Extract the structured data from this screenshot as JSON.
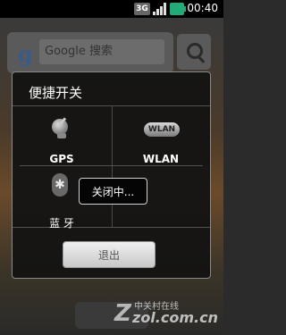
{
  "status_bar": {
    "network": "3G",
    "time": "00:40"
  },
  "home": {
    "search_placeholder": "Google 搜索",
    "google_letter": "g"
  },
  "dialog": {
    "title": "便捷开关",
    "toggles": [
      {
        "label": "GPS",
        "icon": "satellite-dish-icon"
      },
      {
        "label": "WLAN",
        "badge": "WLAN",
        "icon": "wlan-badge-icon"
      },
      {
        "label": "蓝 牙",
        "icon": "bluetooth-icon",
        "glyph": "✱"
      }
    ],
    "toast": "关闭中...",
    "exit_label": "退出"
  },
  "watermark": {
    "top": "中关村在线",
    "bottom": "zol.com.cn"
  }
}
